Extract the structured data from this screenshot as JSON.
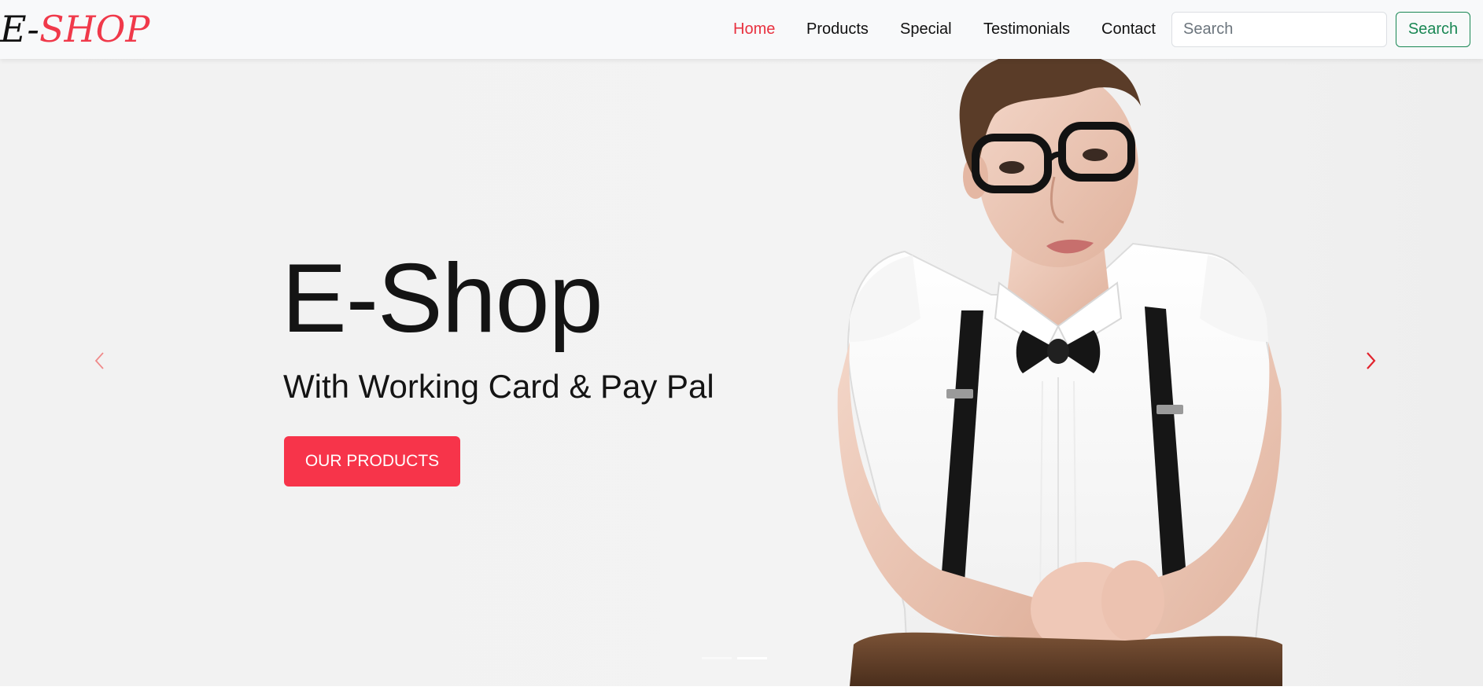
{
  "brand": {
    "part1": "E-",
    "part2": "SHOP"
  },
  "nav": {
    "items": [
      {
        "label": "Home",
        "active": true
      },
      {
        "label": "Products",
        "active": false
      },
      {
        "label": "Special",
        "active": false
      },
      {
        "label": "Testimonials",
        "active": false
      },
      {
        "label": "Contact",
        "active": false
      }
    ],
    "search_placeholder": "Search",
    "search_button": "Search"
  },
  "hero": {
    "title": "E-Shop",
    "subtitle": "With Working Card & Pay Pal",
    "cta": "OUR PRODUCTS",
    "slide_count": 2,
    "active_slide": 2
  },
  "colors": {
    "accent": "#f7344a",
    "nav_active": "#e8313f",
    "search_button": "#198754",
    "navbar_bg": "#f8f9fa"
  },
  "icons": {
    "prev": "chevron-left-icon",
    "next": "chevron-right-icon"
  }
}
